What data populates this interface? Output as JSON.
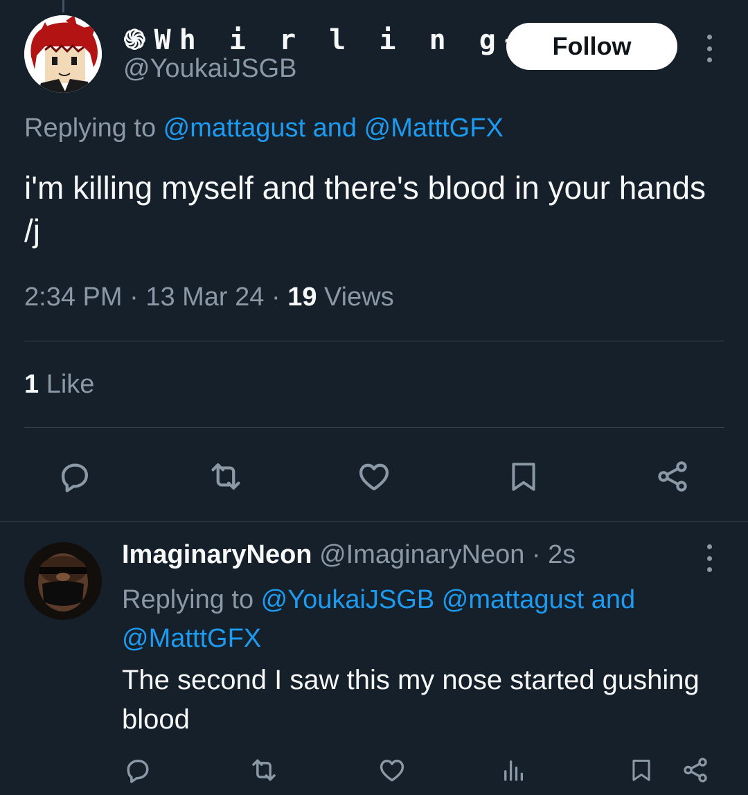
{
  "main_tweet": {
    "display_name_prefix": "֍Wh i r l i n g∼Y o",
    "display_name_ellipsis": "...",
    "handle": "@YoukaiJSGB",
    "follow_label": "Follow",
    "replying_prefix": "Replying to ",
    "replying_mention_1": "@mattagust",
    "replying_joiner": " and ",
    "replying_mention_2": "@MatttGFX",
    "text": "i'm killing myself and there's blood in your hands /j",
    "time": "2:34 PM",
    "sep1": " · ",
    "date": "13 Mar 24",
    "sep2": " · ",
    "views_count": "19",
    "views_label": " Views",
    "likes_count": "1",
    "likes_label": " Like"
  },
  "reply": {
    "display_name": "ImaginaryNeon",
    "handle_time": " @ImaginaryNeon · 2s",
    "replying_prefix": "Replying to ",
    "replying_mention_1": "@YoukaiJSGB",
    "replying_space": " ",
    "replying_mention_2": "@mattagust",
    "replying_joiner": " and ",
    "replying_mention_3": "@MatttGFX",
    "text": "The second I saw this my nose started gushing blood"
  },
  "icons": {
    "actions_main": [
      "reply-icon",
      "retweet-icon",
      "like-icon",
      "bookmark-icon",
      "share-icon"
    ],
    "actions_reply": [
      "reply-icon",
      "retweet-icon",
      "like-icon",
      "analytics-icon",
      "bookmark-icon",
      "share-icon"
    ]
  },
  "colors": {
    "background": "#15202b",
    "link": "#1d9bf0",
    "secondary_text": "#8b98a5",
    "primary_text": "#f7f9f9",
    "divider": "#38444d"
  }
}
